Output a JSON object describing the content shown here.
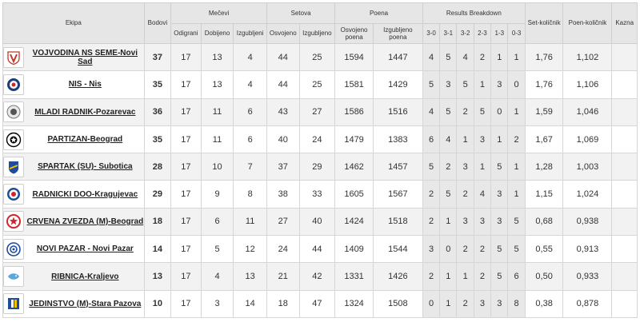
{
  "header": {
    "team": "Ekipa",
    "points": "Bodovi",
    "matches": "Mečevi",
    "sets": "Setova",
    "rally_points": "Poena",
    "breakdown": "Results Breakdown",
    "set_ratio": "Set-količnik",
    "point_ratio": "Poen-količnik",
    "penalty": "Kazna",
    "played": "Odigrani",
    "won": "Dobijeno",
    "lost": "Izgubljeni",
    "sets_won": "Osvojeno",
    "sets_lost": "Izgubljeno",
    "points_won": "Osvojeno poena",
    "points_lost": "Izgubljeno poena",
    "r30": "3-0",
    "r31": "3-1",
    "r32": "3-2",
    "r23": "2-3",
    "r13": "1-3",
    "r03": "0-3"
  },
  "colors": {
    "header_bg": "#e6e6e6",
    "row_alt": "#f2f2f2",
    "border": "#d6d6d6"
  },
  "rows": [
    {
      "team": "VOJVODINA NS SEME-Novi Sad",
      "logo": "vojvodina-logo-icon",
      "points": "37",
      "played": "17",
      "won": "13",
      "lost": "4",
      "sets_won": "44",
      "sets_lost": "25",
      "points_won": "1594",
      "points_lost": "1447",
      "r30": "4",
      "r31": "5",
      "r32": "4",
      "r23": "2",
      "r13": "1",
      "r03": "1",
      "set_ratio": "1,76",
      "point_ratio": "1,102",
      "penalty": ""
    },
    {
      "team": "NIS - Nis",
      "logo": "nis-logo-icon",
      "points": "35",
      "played": "17",
      "won": "13",
      "lost": "4",
      "sets_won": "44",
      "sets_lost": "25",
      "points_won": "1581",
      "points_lost": "1429",
      "r30": "5",
      "r31": "3",
      "r32": "5",
      "r23": "1",
      "r13": "3",
      "r03": "0",
      "set_ratio": "1,76",
      "point_ratio": "1,106",
      "penalty": ""
    },
    {
      "team": "MLADI RADNIK-Pozarevac",
      "logo": "mladi-radnik-logo-icon",
      "points": "36",
      "played": "17",
      "won": "11",
      "lost": "6",
      "sets_won": "43",
      "sets_lost": "27",
      "points_won": "1586",
      "points_lost": "1516",
      "r30": "4",
      "r31": "5",
      "r32": "2",
      "r23": "5",
      "r13": "0",
      "r03": "1",
      "set_ratio": "1,59",
      "point_ratio": "1,046",
      "penalty": ""
    },
    {
      "team": "PARTIZAN-Beograd",
      "logo": "partizan-logo-icon",
      "points": "35",
      "played": "17",
      "won": "11",
      "lost": "6",
      "sets_won": "40",
      "sets_lost": "24",
      "points_won": "1479",
      "points_lost": "1383",
      "r30": "6",
      "r31": "4",
      "r32": "1",
      "r23": "3",
      "r13": "1",
      "r03": "2",
      "set_ratio": "1,67",
      "point_ratio": "1,069",
      "penalty": ""
    },
    {
      "team": "SPARTAK (SU)- Subotica",
      "logo": "spartak-logo-icon",
      "points": "28",
      "played": "17",
      "won": "10",
      "lost": "7",
      "sets_won": "37",
      "sets_lost": "29",
      "points_won": "1462",
      "points_lost": "1457",
      "r30": "5",
      "r31": "2",
      "r32": "3",
      "r23": "1",
      "r13": "5",
      "r03": "1",
      "set_ratio": "1,28",
      "point_ratio": "1,003",
      "penalty": ""
    },
    {
      "team": "RADNICKI DOO-Kragujevac",
      "logo": "radnicki-logo-icon",
      "points": "29",
      "played": "17",
      "won": "9",
      "lost": "8",
      "sets_won": "38",
      "sets_lost": "33",
      "points_won": "1605",
      "points_lost": "1567",
      "r30": "2",
      "r31": "5",
      "r32": "2",
      "r23": "4",
      "r13": "3",
      "r03": "1",
      "set_ratio": "1,15",
      "point_ratio": "1,024",
      "penalty": ""
    },
    {
      "team": "CRVENA ZVEZDA (M)-Beograd",
      "logo": "crvena-zvezda-logo-icon",
      "points": "18",
      "played": "17",
      "won": "6",
      "lost": "11",
      "sets_won": "27",
      "sets_lost": "40",
      "points_won": "1424",
      "points_lost": "1518",
      "r30": "2",
      "r31": "1",
      "r32": "3",
      "r23": "3",
      "r13": "3",
      "r03": "5",
      "set_ratio": "0,68",
      "point_ratio": "0,938",
      "penalty": ""
    },
    {
      "team": "NOVI PAZAR - Novi Pazar",
      "logo": "novi-pazar-logo-icon",
      "points": "14",
      "played": "17",
      "won": "5",
      "lost": "12",
      "sets_won": "24",
      "sets_lost": "44",
      "points_won": "1409",
      "points_lost": "1544",
      "r30": "3",
      "r31": "0",
      "r32": "2",
      "r23": "2",
      "r13": "5",
      "r03": "5",
      "set_ratio": "0,55",
      "point_ratio": "0,913",
      "penalty": ""
    },
    {
      "team": "RIBNICA-Kraljevo",
      "logo": "ribnica-logo-icon",
      "points": "13",
      "played": "17",
      "won": "4",
      "lost": "13",
      "sets_won": "21",
      "sets_lost": "42",
      "points_won": "1331",
      "points_lost": "1426",
      "r30": "2",
      "r31": "1",
      "r32": "1",
      "r23": "2",
      "r13": "5",
      "r03": "6",
      "set_ratio": "0,50",
      "point_ratio": "0,933",
      "penalty": ""
    },
    {
      "team": "JEDINSTVO (M)-Stara Pazova",
      "logo": "jedinstvo-logo-icon",
      "points": "10",
      "played": "17",
      "won": "3",
      "lost": "14",
      "sets_won": "18",
      "sets_lost": "47",
      "points_won": "1324",
      "points_lost": "1508",
      "r30": "0",
      "r31": "1",
      "r32": "2",
      "r23": "3",
      "r13": "3",
      "r03": "8",
      "set_ratio": "0,38",
      "point_ratio": "0,878",
      "penalty": ""
    }
  ]
}
